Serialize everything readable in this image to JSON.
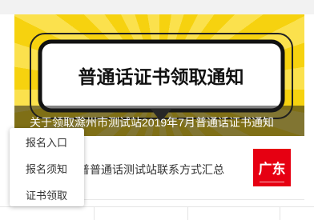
{
  "banner": {
    "headline": "普通话证书领取通知",
    "caption": "关于领取滁州市测试站2019年7月普通话证书通知",
    "background_color": "#f6d20f"
  },
  "news_list": [
    {
      "title": "普普通话测试站联系方式汇总",
      "thumbnail_text": "广东",
      "thumbnail_color": "#e60012"
    }
  ],
  "popup_menu": {
    "items": [
      {
        "label": "报名入口"
      },
      {
        "label": "报名须知"
      },
      {
        "label": "证书领取"
      }
    ]
  }
}
